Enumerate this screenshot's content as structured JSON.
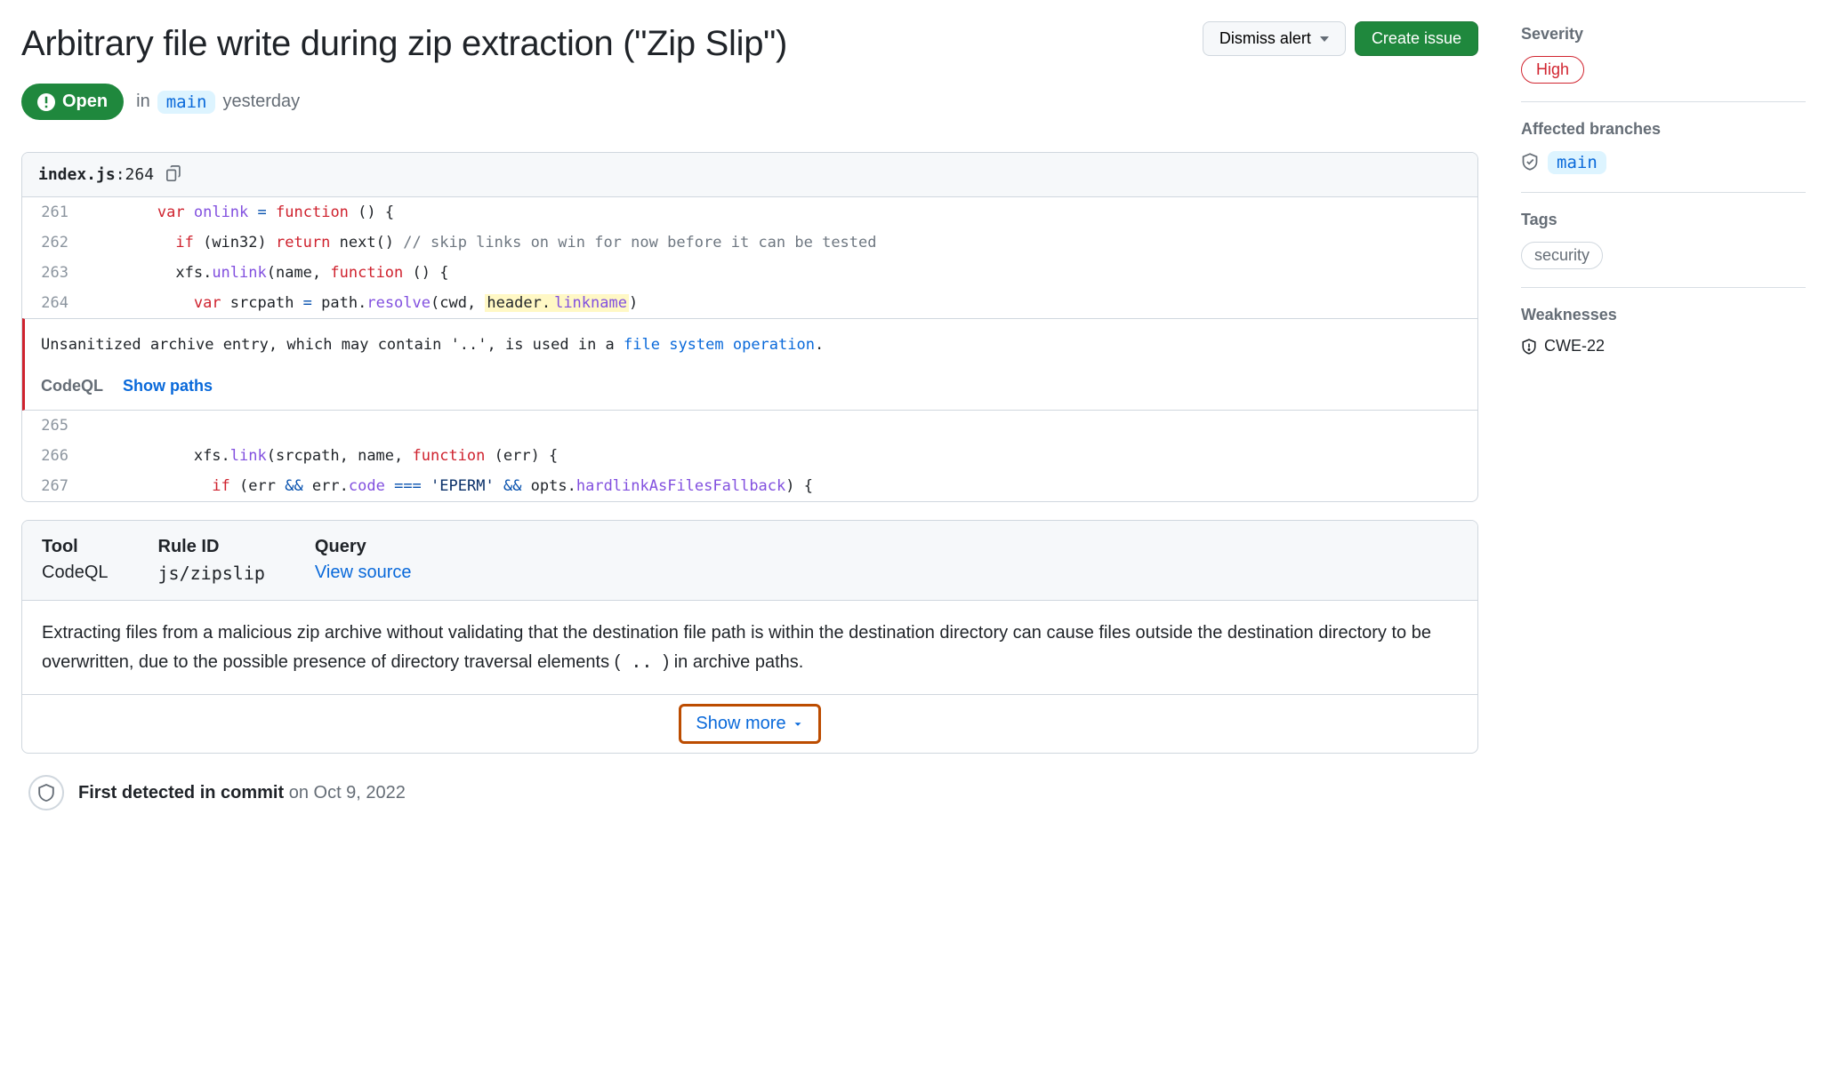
{
  "title": "Arbitrary file write during zip extraction (\"Zip Slip\")",
  "actions": {
    "dismiss": "Dismiss alert",
    "create_issue": "Create issue"
  },
  "status": {
    "label": "Open",
    "in_text": "in",
    "branch": "main",
    "when": "yesterday"
  },
  "file": {
    "name": "index.js",
    "sep": ":",
    "line": "264"
  },
  "code": {
    "lines": [
      {
        "n": "261",
        "indent": "        ",
        "tokens": [
          [
            "kw",
            "var"
          ],
          [
            "",
            " "
          ],
          [
            "fn",
            "onlink"
          ],
          [
            "",
            " "
          ],
          [
            "op",
            "="
          ],
          [
            "",
            " "
          ],
          [
            "kw",
            "function"
          ],
          [
            "",
            " () {"
          ]
        ]
      },
      {
        "n": "262",
        "indent": "          ",
        "tokens": [
          [
            "kw",
            "if"
          ],
          [
            "",
            " (win32) "
          ],
          [
            "kw",
            "return"
          ],
          [
            "",
            " next() "
          ],
          [
            "cmt",
            "// skip links on win for now before it can be tested"
          ]
        ]
      },
      {
        "n": "263",
        "indent": "          ",
        "tokens": [
          [
            "",
            "xfs."
          ],
          [
            "fn",
            "unlink"
          ],
          [
            "",
            "(name, "
          ],
          [
            "kw",
            "function"
          ],
          [
            "",
            " () {"
          ]
        ]
      },
      {
        "n": "264",
        "indent": "            ",
        "tokens": [
          [
            "kw",
            "var"
          ],
          [
            "",
            " srcpath "
          ],
          [
            "op",
            "="
          ],
          [
            "",
            " path."
          ],
          [
            "fn",
            "resolve"
          ],
          [
            "",
            "(cwd, "
          ],
          [
            "hl",
            "header."
          ],
          [
            "hlfn",
            "linkname"
          ],
          [
            "",
            ")"
          ]
        ]
      }
    ],
    "lines_after": [
      {
        "n": "265",
        "indent": "",
        "tokens": []
      },
      {
        "n": "266",
        "indent": "            ",
        "tokens": [
          [
            "",
            "xfs."
          ],
          [
            "fn",
            "link"
          ],
          [
            "",
            "(srcpath, name, "
          ],
          [
            "kw",
            "function"
          ],
          [
            "",
            " (err) {"
          ]
        ]
      },
      {
        "n": "267",
        "indent": "              ",
        "tokens": [
          [
            "kw",
            "if"
          ],
          [
            "",
            " (err "
          ],
          [
            "op",
            "&&"
          ],
          [
            "",
            " err."
          ],
          [
            "fn",
            "code"
          ],
          [
            "",
            " "
          ],
          [
            "op",
            "==="
          ],
          [
            "",
            " "
          ],
          [
            "str",
            "'EPERM'"
          ],
          [
            "",
            " "
          ],
          [
            "op",
            "&&"
          ],
          [
            "",
            " opts."
          ],
          [
            "fn",
            "hardlinkAsFilesFallback"
          ],
          [
            "",
            ") {"
          ]
        ]
      }
    ]
  },
  "finding": {
    "msg_pre": "Unsanitized archive entry, which may contain '..', is used in a ",
    "msg_link": "file system operation",
    "msg_post": ".",
    "tool": "CodeQL",
    "show_paths": "Show paths"
  },
  "info": {
    "cols": [
      {
        "label": "Tool",
        "value": "CodeQL",
        "mono": false
      },
      {
        "label": "Rule ID",
        "value": "js/zipslip",
        "mono": true
      },
      {
        "label": "Query",
        "value": "View source",
        "link": true
      }
    ],
    "body_1": "Extracting files from a malicious zip archive without validating that the destination file path is within the destination directory can cause files outside the destination directory to be overwritten, due to the possible presence of directory traversal elements (",
    "body_mono": " .. ",
    "body_2": ") in archive paths.",
    "show_more": "Show more"
  },
  "timeline": {
    "strong": "First detected in commit",
    "rest": " on Oct 9, 2022"
  },
  "sidebar": {
    "severity": {
      "label": "Severity",
      "value": "High"
    },
    "branches": {
      "label": "Affected branches",
      "items": [
        "main"
      ]
    },
    "tags": {
      "label": "Tags",
      "items": [
        "security"
      ]
    },
    "weaknesses": {
      "label": "Weaknesses",
      "items": [
        "CWE-22"
      ]
    }
  }
}
